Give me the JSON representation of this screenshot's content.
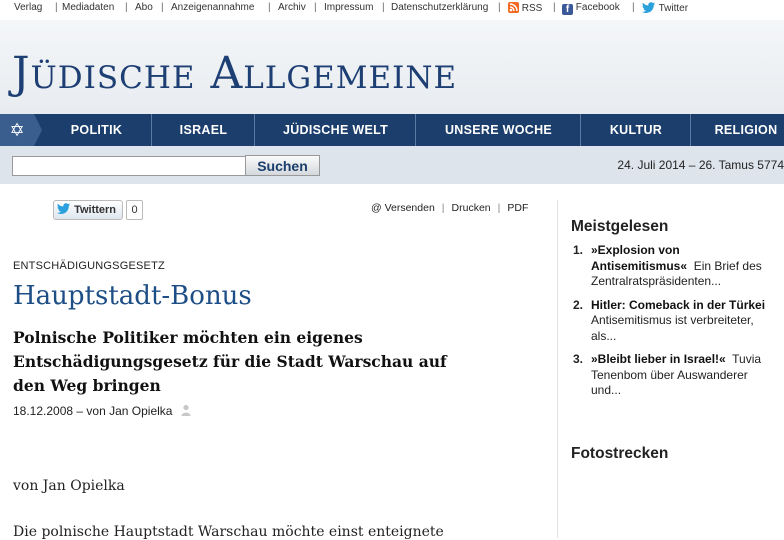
{
  "topnav": {
    "verlag": "Verlag",
    "mediadaten": "Mediadaten",
    "abo": "Abo",
    "anzeigen": "Anzeigenannahme",
    "archiv": "Archiv",
    "impressum": "Impressum",
    "datenschutz": "Datenschutzerklärung",
    "rss": "RSS",
    "facebook": "Facebook",
    "twitter": "Twitter",
    "separator": "|"
  },
  "logo": "Jüdische Allgemeine",
  "mainnav": {
    "star": "✡",
    "tabs": [
      "POLITIK",
      "ISRAEL",
      "JÜDISCHE WELT",
      "UNSERE WOCHE",
      "KULTUR",
      "RELIGION"
    ]
  },
  "search": {
    "value": "",
    "button": "Suchen"
  },
  "date": "24. Juli 2014 – 26. Tamus 5774",
  "share": {
    "twitter_label": "Twittern",
    "twitter_count": "0"
  },
  "tools": {
    "send": "@ Versenden",
    "print": "Drucken",
    "pdf": "PDF",
    "separator": "|"
  },
  "article": {
    "kicker": "ENTSCHÄDIGUNGSGESETZ",
    "title": "Hauptstadt-Bonus",
    "subtitle": "Polnische Politiker möchten ein eigenes Entschädigungsgesetz für die Stadt Warschau auf den Weg bringen",
    "byline": "18.12.2008 – von Jan Opielka",
    "body_author": "von Jan Opielka",
    "body_start": "Die polnische Hauptstadt Warschau möchte einst enteignete"
  },
  "sidebar": {
    "most_read_title": "Meistgelesen",
    "most_read": [
      {
        "num": "1.",
        "title": "»Explosion von Antisemitismus«",
        "desc": "Ein Brief des Zentralratspräsidenten..."
      },
      {
        "num": "2.",
        "title": "Hitler: Comeback in der Türkei",
        "desc": "Antisemitismus ist verbreiteter, als..."
      },
      {
        "num": "3.",
        "title": "»Bleibt lieber in Israel!«",
        "desc": "Tuvia Tenenbom über Auswanderer und..."
      }
    ],
    "photo_title": "Fotostrecken"
  },
  "colors": {
    "brand_blue": "#1d3f73",
    "nav_bg": "#1b3e6c",
    "headline_blue": "#1d4e86"
  }
}
